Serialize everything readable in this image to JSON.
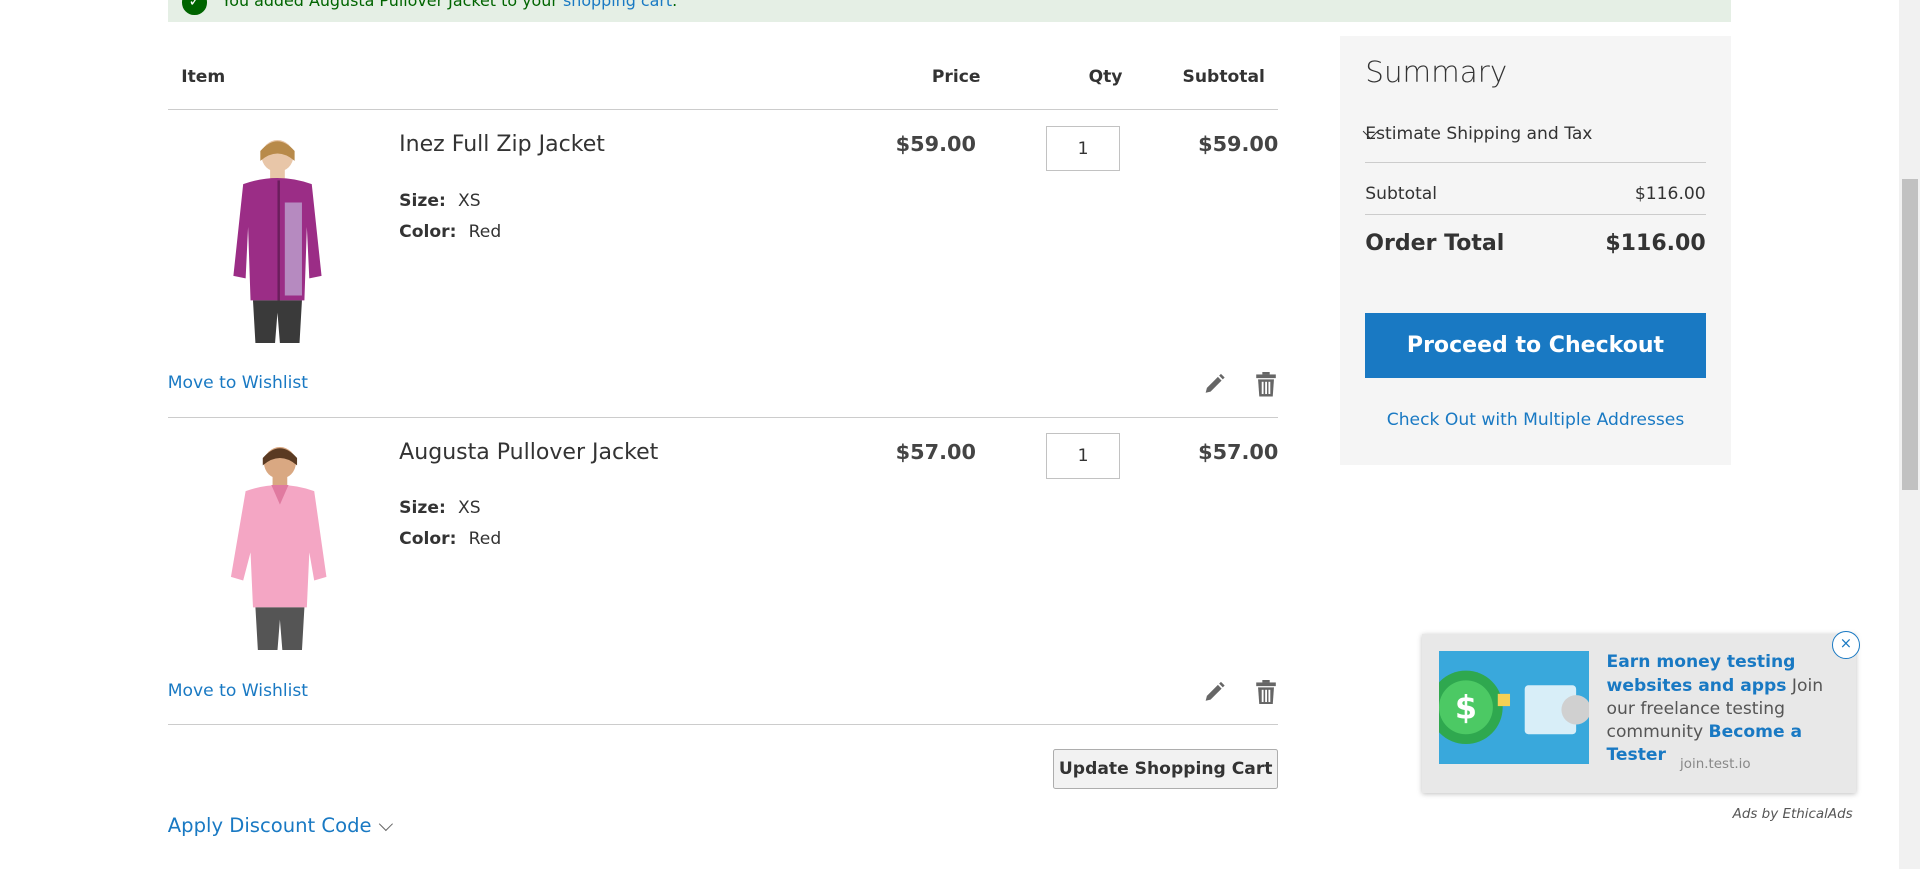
{
  "message": {
    "text": "You added Augusta Pullover Jacket to your ",
    "link": "shopping cart",
    "suffix": "."
  },
  "cart": {
    "headers": {
      "item": "Item",
      "price": "Price",
      "qty": "Qty",
      "subtotal": "Subtotal"
    },
    "items": [
      {
        "name": "Inez Full Zip Jacket",
        "size_label": "Size:",
        "size": "XS",
        "color_label": "Color:",
        "color": "Red",
        "price": "$59.00",
        "qty": "1",
        "subtotal": "$59.00",
        "wishlist": "Move to Wishlist"
      },
      {
        "name": "Augusta Pullover Jacket",
        "size_label": "Size:",
        "size": "XS",
        "color_label": "Color:",
        "color": "Red",
        "price": "$57.00",
        "qty": "1",
        "subtotal": "$57.00",
        "wishlist": "Move to Wishlist"
      }
    ],
    "update_button": "Update Shopping Cart",
    "discount": "Apply Discount Code"
  },
  "summary": {
    "title": "Summary",
    "estimate": "Estimate Shipping and Tax",
    "subtotal_label": "Subtotal",
    "subtotal_value": "$116.00",
    "order_total_label": "Order Total",
    "order_total_value": "$116.00",
    "checkout_button": "Proceed to Checkout",
    "multi_address": "Check Out with Multiple Addresses"
  },
  "ad": {
    "headline": "Earn money testing websites and apps",
    "body": " Join our freelance testing community ",
    "cta": "Become a Tester",
    "domain": "join.test.io",
    "close": "×",
    "attribution": "Ads by EthicalAds"
  },
  "colors": {
    "link": "#1979c3",
    "primary_button": "#1979c3",
    "success": "#006400"
  }
}
